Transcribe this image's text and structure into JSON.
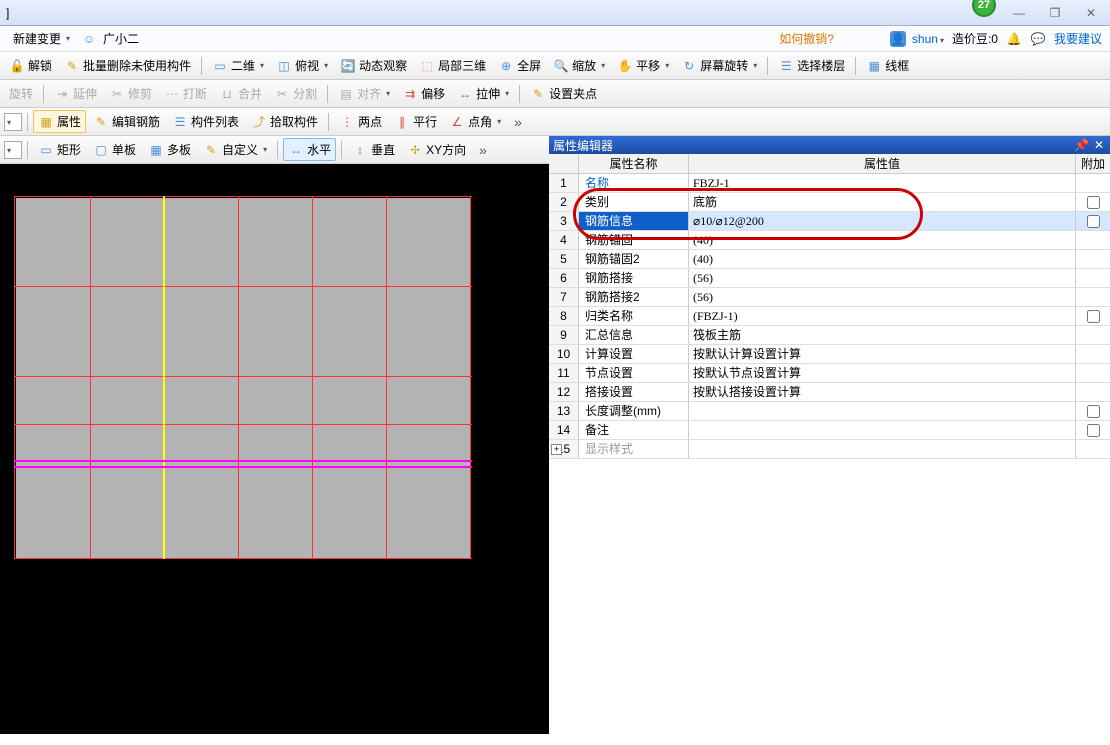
{
  "title_fragment": "]",
  "badge": "27",
  "window_buttons": {
    "min": "—",
    "max": "❐",
    "close": "✕"
  },
  "menubar": {
    "new_change": "新建变更",
    "helper_char": "广小二",
    "how_undo": "如何撤销?",
    "user": "shun",
    "cost_bean": "造价豆:0",
    "suggest": "我要建议"
  },
  "toolbar1": {
    "unlock": "解锁",
    "batch_delete": "批量删除未使用构件",
    "two_d": "二维",
    "bird": "俯视",
    "dynamic": "动态观察",
    "local3d": "局部三维",
    "fullscreen": "全屏",
    "zoom": "缩放",
    "pan": "平移",
    "screen_rotate": "屏幕旋转",
    "select_floor": "选择楼层",
    "wireframe": "线框"
  },
  "toolbar2": {
    "rotate": "旋转",
    "extend": "延伸",
    "trim": "修剪",
    "break": "打断",
    "merge": "合并",
    "split": "分割",
    "align": "对齐",
    "offset": "偏移",
    "stretch": "拉伸",
    "clamp": "设置夹点"
  },
  "toolbar3": {
    "props": "属性",
    "edit_rebar": "编辑钢筋",
    "list": "构件列表",
    "pick": "拾取构件",
    "two_point": "两点",
    "parallel": "平行",
    "angle": "点角"
  },
  "toolbar4": {
    "rect": "矩形",
    "single": "单板",
    "multi": "多板",
    "custom": "自定义",
    "horiz": "水平",
    "vert": "垂直",
    "xy": "XY方向"
  },
  "panel": {
    "title": "属性编辑器",
    "col_name": "属性名称",
    "col_value": "属性值",
    "col_add": "附加"
  },
  "rows": [
    {
      "n": "1",
      "name": "名称",
      "val": "FBZJ-1",
      "link": true,
      "chk": null
    },
    {
      "n": "2",
      "name": "类别",
      "val": "底筋",
      "chk": false
    },
    {
      "n": "3",
      "name": "钢筋信息",
      "val": "⌀10/⌀12@200",
      "sel": true,
      "chk": false
    },
    {
      "n": "4",
      "name": "钢筋锚固",
      "val": "(40)",
      "chk": null
    },
    {
      "n": "5",
      "name": "钢筋锚固2",
      "val": "(40)",
      "chk": null
    },
    {
      "n": "6",
      "name": "钢筋搭接",
      "val": "(56)",
      "chk": null
    },
    {
      "n": "7",
      "name": "钢筋搭接2",
      "val": "(56)",
      "chk": null
    },
    {
      "n": "8",
      "name": "归类名称",
      "val": "(FBZJ-1)",
      "chk": false
    },
    {
      "n": "9",
      "name": "汇总信息",
      "val": "筏板主筋",
      "chk": null
    },
    {
      "n": "10",
      "name": "计算设置",
      "val": "按默认计算设置计算",
      "chk": null
    },
    {
      "n": "11",
      "name": "节点设置",
      "val": "按默认节点设置计算",
      "chk": null
    },
    {
      "n": "12",
      "name": "搭接设置",
      "val": "按默认搭接设置计算",
      "chk": null
    },
    {
      "n": "13",
      "name": "长度调整(mm)",
      "val": "",
      "chk": false
    },
    {
      "n": "14",
      "name": "备注",
      "val": "",
      "chk": false
    },
    {
      "n": "15",
      "name": "显示样式",
      "val": "",
      "expand": true,
      "gray": true
    }
  ]
}
